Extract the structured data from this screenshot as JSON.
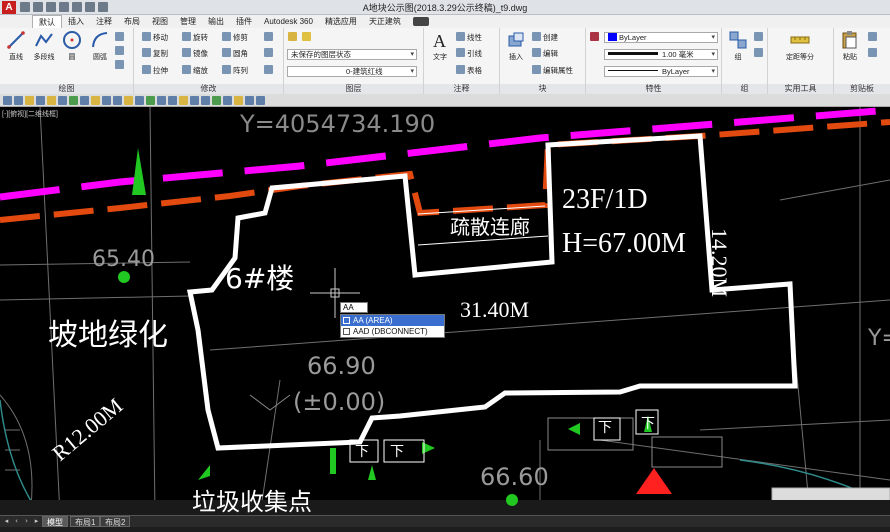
{
  "window": {
    "app_logo": "A",
    "title": "A地块公示图(2018.3.29公示终稿)_t9.dwg"
  },
  "menu": {
    "tabs": [
      "默认",
      "插入",
      "注释",
      "布局",
      "视图",
      "管理",
      "输出",
      "插件",
      "Autodesk 360",
      "精选应用",
      "天正建筑"
    ],
    "active": "默认"
  },
  "ribbon": {
    "draw": {
      "title": "绘图",
      "line": "直线",
      "polyline": "多段线",
      "circle": "圆",
      "arc": "圆弧"
    },
    "modify": {
      "title": "修改",
      "move": "移动",
      "rotate": "旋转",
      "trim": "修剪",
      "copy": "复制",
      "mirror": "镜像",
      "fillet": "圆角",
      "stretch": "拉伸",
      "scale": "缩放",
      "array": "阵列"
    },
    "layers": {
      "title": "图层",
      "layer_state": "未保存的图层状态",
      "current_layer": "0-建筑红线"
    },
    "annotation": {
      "title": "注释",
      "text": "文字",
      "linear": "线性",
      "leader": "引线",
      "table": "表格"
    },
    "block": {
      "title": "块",
      "insert": "插入",
      "create": "创建",
      "edit": "编辑",
      "edit_attrs": "编辑属性"
    },
    "properties": {
      "title": "特性",
      "color": "ByLayer",
      "lineweight": "1.00 毫米",
      "linetype": "ByLayer",
      "color_hex": "#0000ff"
    },
    "group": {
      "title": "组",
      "label": "组"
    },
    "utilities": {
      "title": "实用工具",
      "measure": "定距等分"
    },
    "clipboard": {
      "title": "剪贴板",
      "paste": "粘贴"
    }
  },
  "viewport": {
    "label": "[-][俯视][二维线框]"
  },
  "drawing": {
    "coord_y": "Y=4054734.190",
    "elev_1": "65.40",
    "elev_2": "66.90",
    "elev_3": "(±0.00)",
    "elev_4": "66.60",
    "building": "6#楼",
    "floors": "23F/1D",
    "height": "H=67.00M",
    "corridor": "疏散连廊",
    "width": "31.40M",
    "depth": "14.20M",
    "slope_green": "坡地绿化",
    "radius": "R12.00M",
    "garbage": "垃圾收集点",
    "down_1": "下",
    "down_2": "下",
    "down_3": "下",
    "down_4": "下",
    "y_right": "Y=",
    "colors": {
      "property_line": "#ff00ff",
      "red_line": "#e24a10",
      "building": "#ffffff",
      "arrow": "#22c822",
      "marker": "#ff2020",
      "dim_grey": "#9a9a9a"
    }
  },
  "autocomplete": {
    "input": "AA",
    "items": [
      "AA (AREA)",
      "AAD (DBCONNECT)"
    ],
    "selected_index": 0
  },
  "layout_tabs": {
    "model": "模型",
    "layout1": "布局1",
    "layout2": "布局2",
    "active": "模型"
  }
}
